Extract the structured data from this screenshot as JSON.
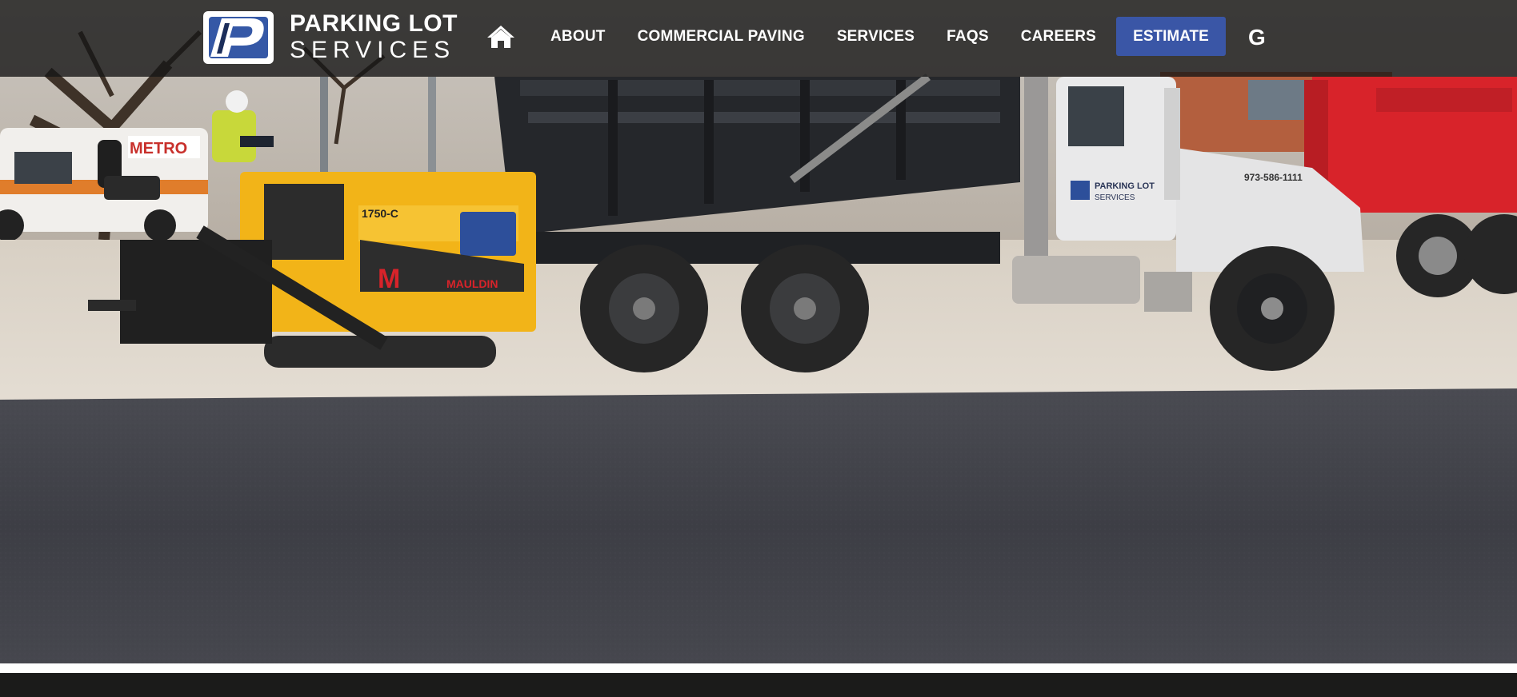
{
  "header": {
    "logo": {
      "line1": "PARKING LOT",
      "line2": "SERVICES",
      "mark_letter": "P"
    },
    "nav": {
      "home_icon": "home-icon",
      "items": [
        {
          "label": "ABOUT"
        },
        {
          "label": "COMMERCIAL PAVING"
        },
        {
          "label": "SERVICES"
        },
        {
          "label": "FAQS"
        },
        {
          "label": "CAREERS"
        }
      ]
    },
    "estimate_label": "ESTIMATE",
    "google_label": "G"
  },
  "hero": {
    "paver": {
      "model": "1750-C",
      "brand_letter": "M",
      "brand_name": "MAULDIN"
    },
    "truck": {
      "phone": "973-586-1111",
      "door_line1": "PARKING LOT",
      "door_line2": "SERVICES"
    },
    "van_text": "METRO"
  },
  "colors": {
    "accent": "#3a56a6",
    "header_bg": "#161616",
    "asphalt": "#3f4046",
    "paver_yellow": "#f2b418",
    "red_truck": "#d8232a"
  }
}
